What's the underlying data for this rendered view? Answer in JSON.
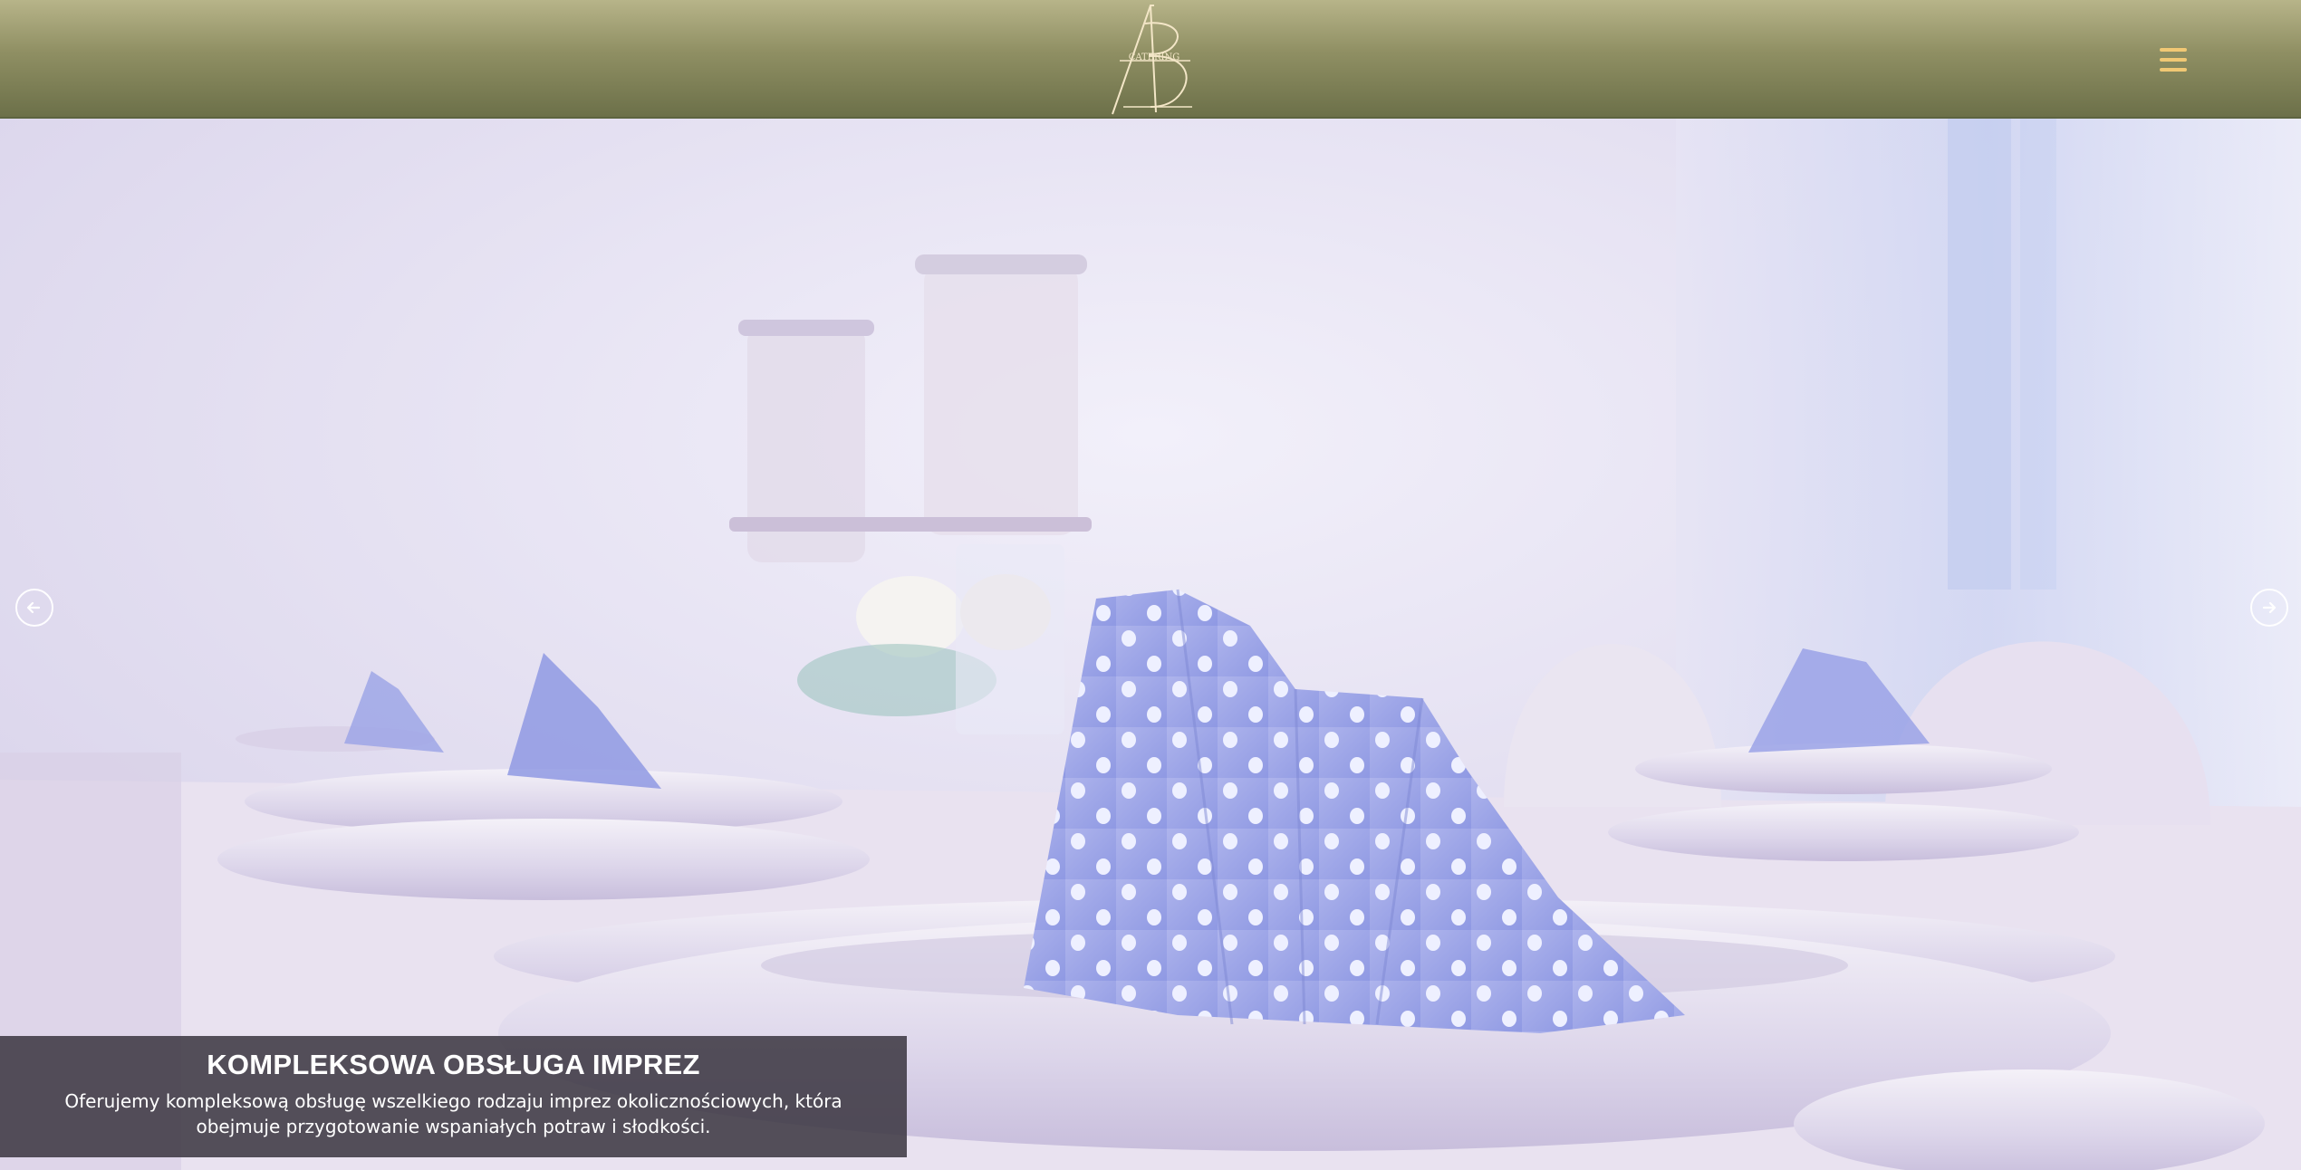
{
  "header": {
    "logo_name": "AB catering logo",
    "logo_text": "CATERING",
    "menu_icon": "hamburger-menu-icon"
  },
  "slider": {
    "prev_icon": "arrow-left-icon",
    "next_icon": "arrow-right-icon",
    "caption": {
      "title": "KOMPLEKSOWA OBSŁUGA IMPREZ",
      "text": "Oferujemy kompleksową obsługę wszelkiego rodzaju imprez okolicznościowych, która obejmuje przygotowanie wspaniałych potraw i słodkości."
    }
  },
  "colors": {
    "header_top": "#b7b489",
    "header_bottom": "#6c7049",
    "menu_icon": "#f1c874",
    "caption_bg": "#3a3640"
  }
}
